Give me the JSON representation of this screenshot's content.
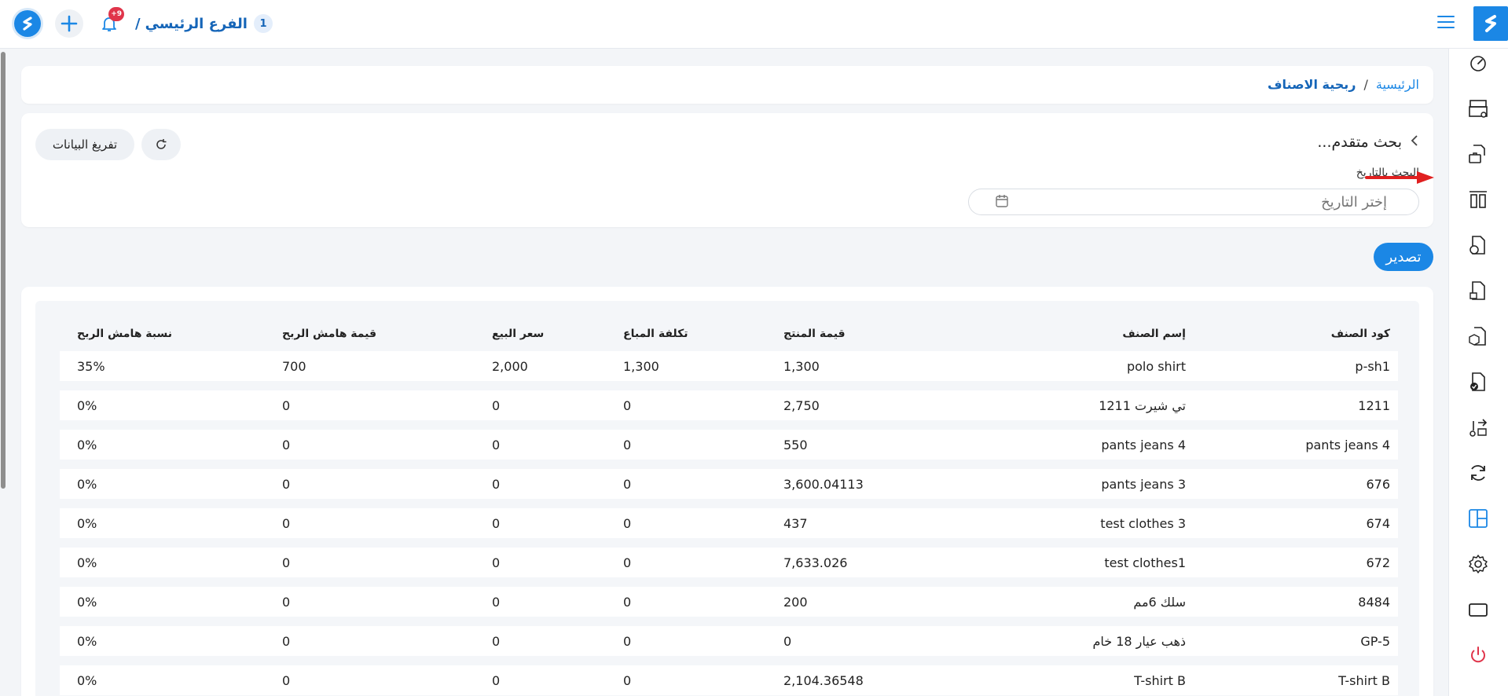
{
  "header": {
    "branch_number": "1",
    "branch_name": "الفرع الرئيسي",
    "branch_separator": "/",
    "notification_count": "+9"
  },
  "breadcrumb": {
    "home": "الرئيسية",
    "separator": "/",
    "current": "ربحية الاصناف"
  },
  "search": {
    "title": "بحث متقدم...",
    "date_label": "البحث بالتاريخ",
    "date_placeholder": "إختر التاريخ",
    "clear_label": "تفريغ البيانات"
  },
  "export_label": "تصدير",
  "table": {
    "headers": [
      "كود الصنف",
      "إسم الصنف",
      "قيمة المنتج",
      "تكلفة المباع",
      "سعر البيع",
      "قيمة هامش الربح",
      "نسبة هامش الربح"
    ],
    "rows": [
      [
        "p-sh1",
        "polo shirt",
        "1,300",
        "1,300",
        "2,000",
        "700",
        "35%"
      ],
      [
        "1211",
        "تي شيرت 1211",
        "2,750",
        "0",
        "0",
        "0",
        "0%"
      ],
      [
        "4 pants jeans",
        "4 pants jeans",
        "550",
        "0",
        "0",
        "0",
        "0%"
      ],
      [
        "676",
        "3 pants jeans",
        "3,600.04113",
        "0",
        "0",
        "0",
        "0%"
      ],
      [
        "674",
        "test clothes 3",
        "437",
        "0",
        "0",
        "0",
        "0%"
      ],
      [
        "672",
        "test clothes1",
        "7,633.026",
        "0",
        "0",
        "0",
        "0%"
      ],
      [
        "8484",
        "سلك 6مم",
        "200",
        "0",
        "0",
        "0",
        "0%"
      ],
      [
        "GP-5",
        "ذهب عيار 18 خام",
        "0",
        "0",
        "0",
        "0",
        "0%"
      ],
      [
        "T-shirt B",
        "T-shirt B",
        "2,104.36548",
        "0",
        "0",
        "0",
        "0%"
      ]
    ]
  },
  "sidebar": {
    "items": [
      "speedometer-icon",
      "pos-register-icon",
      "invoice-briefcase-icon",
      "columns-icon",
      "document-money-icon",
      "document-download-icon",
      "document-box-icon",
      "document-check-icon",
      "transfer-icon",
      "sync-icon",
      "layout-icon",
      "gear-icon",
      "monitor-icon",
      "power-icon"
    ],
    "active": "layout-icon"
  },
  "colors": {
    "accent": "#1b87e5",
    "dark_accent": "#1565b8",
    "danger": "#e0344a",
    "arrow": "#e02020"
  }
}
